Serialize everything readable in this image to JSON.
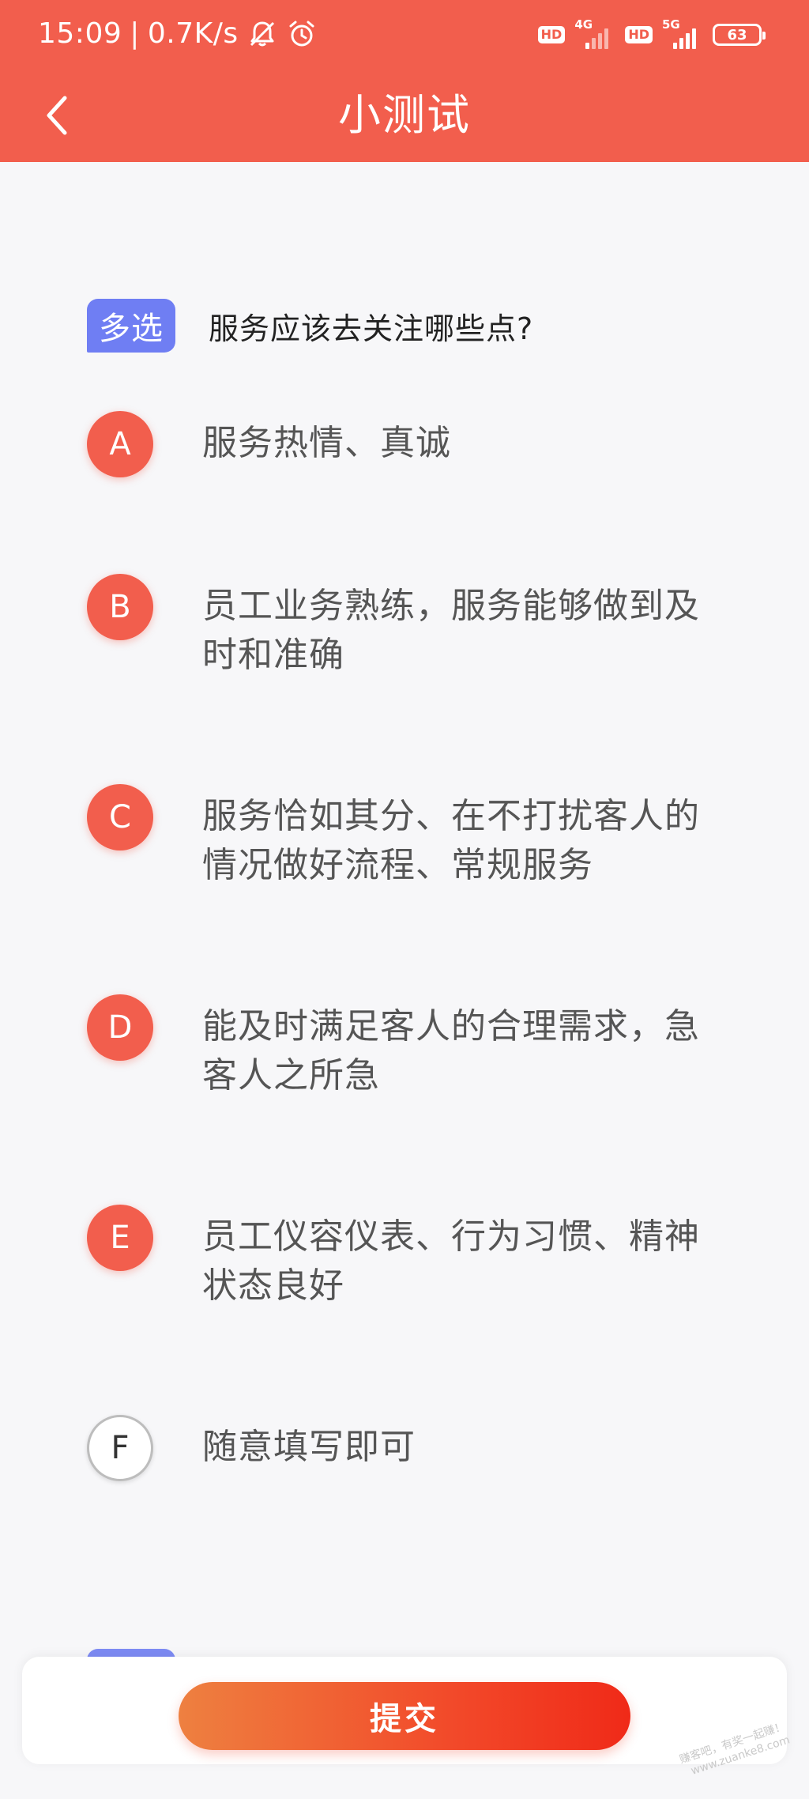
{
  "status_bar": {
    "time": "15:09",
    "separator": "|",
    "net_speed": "0.7K/s",
    "icons": [
      "mute-icon",
      "alarm-icon"
    ],
    "hd_label": "HD",
    "network_1": "4G",
    "network_2": "5G",
    "battery": "63"
  },
  "header": {
    "title": "小测试",
    "back_icon": "chevron-left-icon"
  },
  "question": {
    "type_tag": "多选",
    "text": "服务应该去关注哪些点?"
  },
  "options": [
    {
      "letter": "A",
      "text": "服务热情、真诚",
      "selected": true
    },
    {
      "letter": "B",
      "text": "员工业务熟练，服务能够做到及时和准确",
      "selected": true
    },
    {
      "letter": "C",
      "text": "服务恰如其分、在不打扰客人的情况做好流程、常规服务",
      "selected": true
    },
    {
      "letter": "D",
      "text": "能及时满足客人的合理需求，急客人之所急",
      "selected": true
    },
    {
      "letter": "E",
      "text": "员工仪容仪表、行为习惯、精神状态良好",
      "selected": true
    },
    {
      "letter": "F",
      "text": "随意填写即可",
      "selected": false
    }
  ],
  "footer": {
    "submit_label": "提交"
  },
  "watermark": {
    "line1": "赚客吧，有奖一起赚！",
    "line2": "www.zuanke8.com"
  },
  "colors": {
    "primary": "#f25e4d",
    "tag": "#6f7ef3",
    "background": "#f7f7f9",
    "option_text": "#555555"
  }
}
